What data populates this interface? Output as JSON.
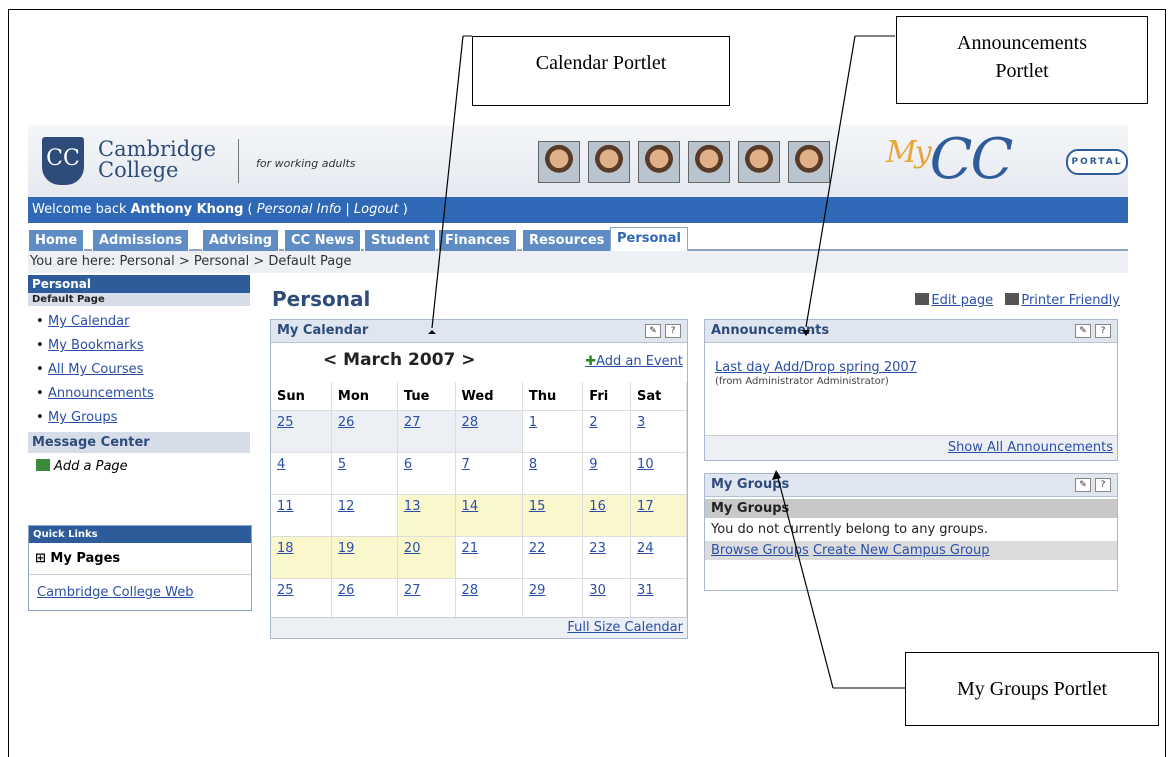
{
  "header": {
    "logo_crest": "CC",
    "logo_line1": "Cambridge",
    "logo_line2": "College",
    "tagline": "for working adults",
    "brand_my": "My",
    "brand_cc": "CC",
    "brand_portal": "PORTAL"
  },
  "welcome": {
    "prefix": "Welcome back ",
    "name": "Anthony Khong",
    "open": " ( ",
    "personal_info": "Personal Info",
    "sep": " | ",
    "logout": "Logout",
    "close": " )"
  },
  "tabs": [
    "Home",
    "Admissions",
    "Advising",
    "CC News",
    "Student",
    "Finances",
    "Resources",
    "Personal"
  ],
  "breadcrumb": "You are here:  Personal > Personal > Default Page",
  "sidebar": {
    "heading": "Personal",
    "subheading": "Default Page",
    "items": [
      "My Calendar",
      "My Bookmarks",
      "All My Courses",
      "Announcements",
      "My Groups"
    ],
    "message_center": "Message Center",
    "add_page": "Add a Page",
    "quick_links_heading": "Quick Links",
    "my_pages": "⊞ My Pages",
    "college_web": "Cambridge College Web"
  },
  "main": {
    "title": "Personal",
    "edit_page": "Edit page",
    "printer_friendly": "Printer Friendly"
  },
  "calendar": {
    "title": "My Calendar",
    "month_nav": "< March 2007 >",
    "add_event": "Add an Event",
    "weekdays": [
      "Sun",
      "Mon",
      "Tue",
      "Wed",
      "Thu",
      "Fri",
      "Sat"
    ],
    "weeks": [
      [
        "25",
        "26",
        "27",
        "28",
        "1",
        "2",
        "3"
      ],
      [
        "4",
        "5",
        "6",
        "7",
        "8",
        "9",
        "10"
      ],
      [
        "11",
        "12",
        "13",
        "14",
        "15",
        "16",
        "17"
      ],
      [
        "18",
        "19",
        "20",
        "21",
        "22",
        "23",
        "24"
      ],
      [
        "25",
        "26",
        "27",
        "28",
        "29",
        "30",
        "31"
      ]
    ],
    "footer": "Full Size Calendar"
  },
  "announcements": {
    "title": "Announcements",
    "item": "Last day Add/Drop spring 2007",
    "from": "(from Administrator Administrator)",
    "footer": "Show All Announcements"
  },
  "groups": {
    "title": "My Groups",
    "subheading": "My Groups",
    "message": "You do not currently belong to any groups.",
    "browse": "Browse Groups",
    "create": "Create New Campus Group"
  },
  "callouts": {
    "calendar": "Calendar Portlet",
    "announcements_line1": "Announcements",
    "announcements_line2": "Portlet",
    "groups": "My Groups Portlet"
  },
  "icons": [
    "edit-icon",
    "printer-icon",
    "settings-icon",
    "help-icon",
    "add-icon",
    "plus-icon"
  ]
}
